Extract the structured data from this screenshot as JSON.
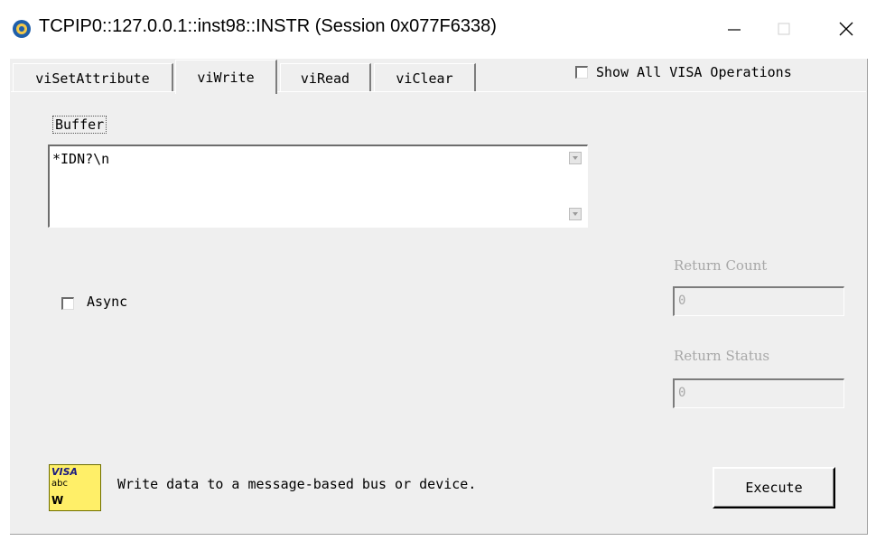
{
  "window": {
    "title": "TCPIP0::127.0.0.1::inst98::INSTR (Session 0x077F6338)"
  },
  "tabs": [
    {
      "label": "viSetAttribute"
    },
    {
      "label": "viWrite"
    },
    {
      "label": "viRead"
    },
    {
      "label": "viClear"
    }
  ],
  "active_tab": "viWrite",
  "show_all": {
    "label": "Show All VISA Operations",
    "checked": false
  },
  "buffer": {
    "label": "Buffer",
    "value": "*IDN?\\n"
  },
  "async": {
    "label": "Async",
    "checked": false
  },
  "return_count": {
    "label": "Return Count",
    "value": "0"
  },
  "return_status": {
    "label": "Return Status",
    "value": "0"
  },
  "visa_icon": {
    "line1": "VISA",
    "line2": "abc",
    "line3": "W"
  },
  "description": "Write data to a message-based bus or device.",
  "execute_label": "Execute",
  "colors": {
    "background": "#efefef",
    "icon_yellow": "#ffef68",
    "disabled_text": "#a8a8a8"
  }
}
